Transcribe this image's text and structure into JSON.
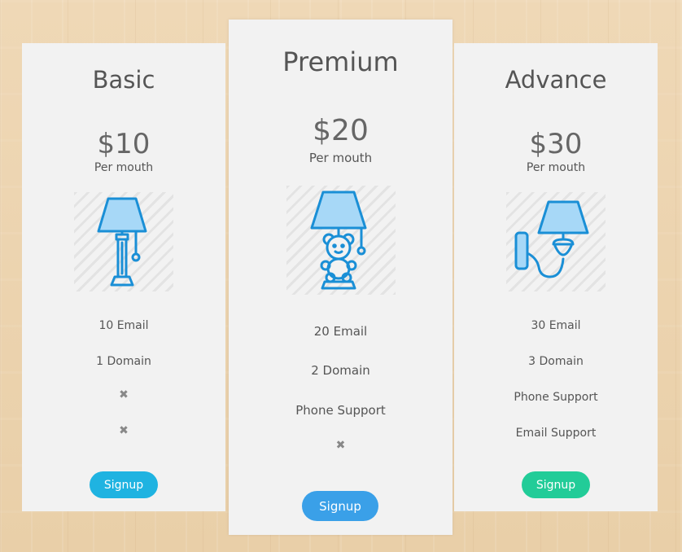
{
  "plans": [
    {
      "name": "Basic",
      "price": "$10",
      "period": "Per mouth",
      "icon": "table-lamp-icon",
      "features": [
        "10 Email",
        "1 Domain",
        "✖",
        "✖"
      ],
      "button": "Signup",
      "button_color": "#1fb3e1"
    },
    {
      "name": "Premium",
      "price": "$20",
      "period": "Per mouth",
      "icon": "teddy-bear-lamp-icon",
      "features": [
        "20 Email",
        "2 Domain",
        "Phone Support",
        "✖"
      ],
      "button": "Signup",
      "button_color": "#3aa0e8"
    },
    {
      "name": "Advance",
      "price": "$30",
      "period": "Per mouth",
      "icon": "wall-lamp-icon",
      "features": [
        "30 Email",
        "3 Domain",
        "Phone Support",
        "Email Support"
      ],
      "button": "Signup",
      "button_color": "#22cc98"
    }
  ],
  "colors": {
    "icon_stroke": "#1a8fd6",
    "icon_fill": "#a7d8f7",
    "card_bg": "#f2f2f2",
    "background": "#ecd3ae"
  }
}
